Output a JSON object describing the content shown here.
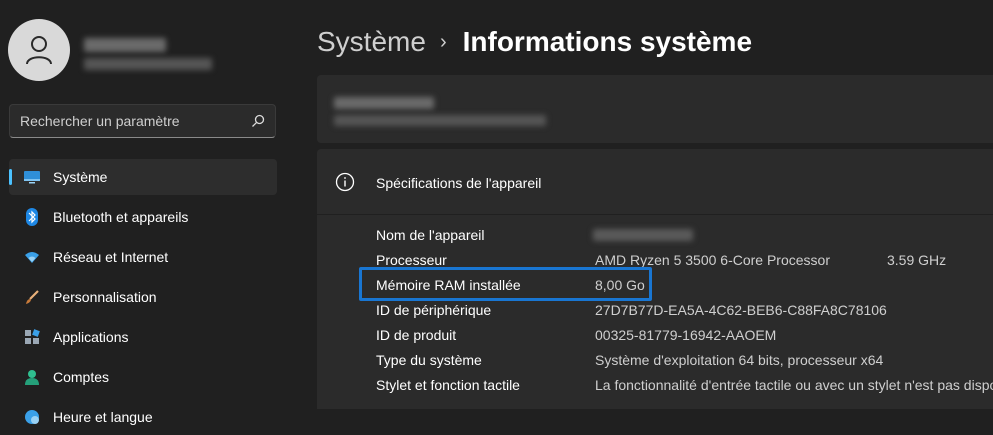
{
  "user": {},
  "search": {
    "placeholder": "Rechercher un paramètre"
  },
  "sidebar": {
    "items": [
      {
        "label": "Système",
        "icon": "monitor-icon",
        "active": true
      },
      {
        "label": "Bluetooth et appareils",
        "icon": "bluetooth-icon"
      },
      {
        "label": "Réseau et Internet",
        "icon": "wifi-icon"
      },
      {
        "label": "Personnalisation",
        "icon": "brush-icon"
      },
      {
        "label": "Applications",
        "icon": "apps-icon"
      },
      {
        "label": "Comptes",
        "icon": "person-icon"
      },
      {
        "label": "Heure et langue",
        "icon": "globe-clock-icon"
      }
    ]
  },
  "header": {
    "parent": "Système",
    "separator": "›",
    "current": "Informations système"
  },
  "specs": {
    "title": "Spécifications de l'appareil",
    "rows": [
      {
        "label": "Nom de l'appareil",
        "value": ""
      },
      {
        "label": "Processeur",
        "value": "AMD Ryzen 5 3500 6-Core Processor",
        "value2": "3.59 GHz"
      },
      {
        "label": "Mémoire RAM installée",
        "value": "8,00 Go"
      },
      {
        "label": "ID de périphérique",
        "value": "27D7B77D-EA5A-4C62-BEB6-C88FA8C78106"
      },
      {
        "label": "ID de produit",
        "value": "00325-81779-16942-AAOEM"
      },
      {
        "label": "Type du système",
        "value": "Système d'exploitation 64 bits, processeur x64"
      },
      {
        "label": "Stylet et fonction tactile",
        "value": "La fonctionnalité d'entrée tactile ou avec un stylet n'est pas dispo"
      }
    ]
  },
  "colors": {
    "accent": "#4cc2ff",
    "highlight_border": "#1976d2",
    "background": "#202020",
    "card": "#2b2b2b"
  }
}
